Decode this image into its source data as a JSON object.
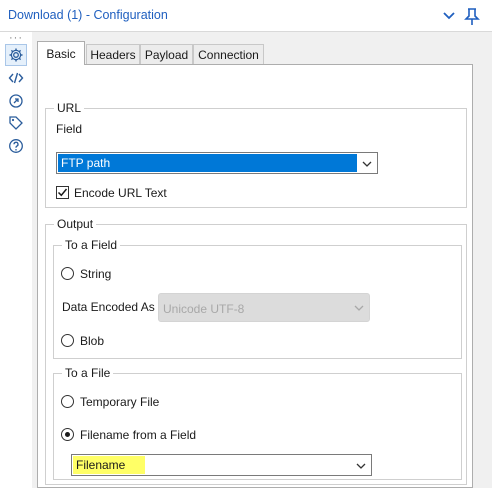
{
  "window": {
    "title": "Download (1) - Configuration"
  },
  "tabs": [
    {
      "label": "Basic",
      "active": true
    },
    {
      "label": "Headers",
      "active": false
    },
    {
      "label": "Payload",
      "active": false
    },
    {
      "label": "Connection",
      "active": false
    }
  ],
  "url_group": {
    "legend": "URL",
    "field_label": "Field",
    "field_value": "FTP path",
    "encode_label": "Encode URL Text",
    "encode_checked": true
  },
  "output_group": {
    "legend": "Output",
    "to_field": {
      "legend": "To a Field",
      "string_label": "String",
      "encoding_label": "Data Encoded As",
      "encoding_value": "Unicode UTF-8",
      "blob_label": "Blob"
    },
    "to_file": {
      "legend": "To a File",
      "temporary_label": "Temporary File",
      "from_field_label": "Filename from a Field",
      "filename_value": "Filename",
      "selected": "from_field"
    }
  },
  "colors": {
    "title": "#1f5fbf",
    "selection": "#0078d7",
    "highlight": "#ffff66",
    "panel_bg": "#f0f0f0"
  },
  "icons": [
    "chevron-down-icon",
    "pin-icon",
    "gear-icon",
    "code-icon",
    "target-icon",
    "tag-icon",
    "help-icon"
  ]
}
